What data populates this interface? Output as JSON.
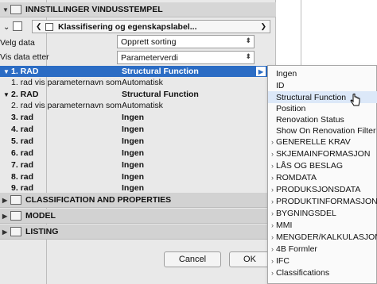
{
  "header": {
    "title": "INNSTILLINGER VINDUSSTEMPEL",
    "subpanel": "Klassifisering og egenskapslabel..."
  },
  "fields": {
    "velg_label": "Velg data",
    "velg_value": "Opprett sorting",
    "vis_label": "Vis data etter",
    "vis_value": "Parameterverdi"
  },
  "rows": [
    {
      "label": "1. RAD",
      "value": "Structural Function"
    },
    {
      "label": "1. rad vis parameternavn som",
      "value": "Automatisk"
    },
    {
      "label": "2. RAD",
      "value": "Structural Function"
    },
    {
      "label": "2. rad vis parameternavn som",
      "value": "Automatisk"
    },
    {
      "label": "3. rad",
      "value": "Ingen"
    },
    {
      "label": "4. rad",
      "value": "Ingen"
    },
    {
      "label": "5. rad",
      "value": "Ingen"
    },
    {
      "label": "6. rad",
      "value": "Ingen"
    },
    {
      "label": "7. rad",
      "value": "Ingen"
    },
    {
      "label": "8. rad",
      "value": "Ingen"
    },
    {
      "label": "9. rad",
      "value": "Ingen"
    }
  ],
  "sections": [
    {
      "label": "CLASSIFICATION AND PROPERTIES"
    },
    {
      "label": "MODEL"
    },
    {
      "label": "LISTING"
    }
  ],
  "buttons": {
    "cancel": "Cancel",
    "ok": "OK"
  },
  "menu": [
    {
      "label": "Ingen",
      "chevron": false
    },
    {
      "label": "ID",
      "chevron": false
    },
    {
      "label": "Structural Function",
      "chevron": false
    },
    {
      "label": "Position",
      "chevron": false
    },
    {
      "label": "Renovation Status",
      "chevron": false
    },
    {
      "label": "Show On Renovation Filter",
      "chevron": false
    },
    {
      "label": "GENERELLE KRAV",
      "chevron": true
    },
    {
      "label": "SKJEMAINFORMASJON",
      "chevron": true
    },
    {
      "label": "LÅS OG BESLAG",
      "chevron": true
    },
    {
      "label": "ROMDATA",
      "chevron": true
    },
    {
      "label": "PRODUKSJONSDATA",
      "chevron": true
    },
    {
      "label": "PRODUKTINFORMASJON",
      "chevron": true
    },
    {
      "label": "BYGNINGSDEL",
      "chevron": true
    },
    {
      "label": "MMI",
      "chevron": true
    },
    {
      "label": "MENGDER/KALKULASJON",
      "chevron": true
    },
    {
      "label": "4B Formler",
      "chevron": true
    },
    {
      "label": "IFC",
      "chevron": true
    },
    {
      "label": "Classifications",
      "chevron": true
    }
  ],
  "colors": {
    "selection": "#2b6cc4",
    "hover": "#dce8f8"
  }
}
